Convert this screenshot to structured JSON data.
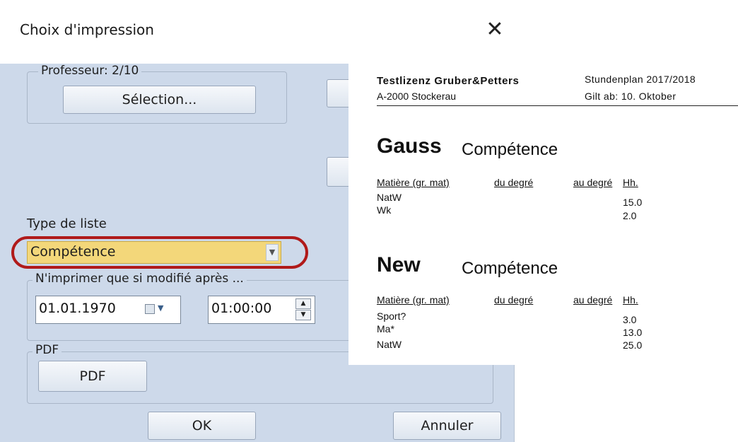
{
  "dialog": {
    "title": "Choix d'impression",
    "close_glyph": "✕",
    "professeur_legend": "Professeur: 2/10",
    "selection_button": "Sélection...",
    "type_liste_label": "Type de liste",
    "type_liste_value": "Compétence",
    "modified_legend": "N'imprimer que si modifié après ...",
    "date_value": "01.01.1970",
    "time_value": "01:00:00",
    "pdf_legend": "PDF",
    "pdf_button": "PDF",
    "ok_button": "OK",
    "cancel_button": "Annuler",
    "highlight_color": "#b01a1a",
    "selected_bg": "#f3d77a"
  },
  "preview": {
    "school": "Testlizenz Gruber&Petters",
    "address": "A-2000 Stockerau",
    "plan": "Stundenplan 2017/2018",
    "valid_from": "Gilt ab: 10. Oktober",
    "col_headers": {
      "subject": "Matière (gr. mat)",
      "from": "du degré",
      "to": "au degré",
      "hours": "Hh."
    },
    "teachers": [
      {
        "name": "Gauss",
        "type": "Compétence",
        "rows": [
          {
            "subject": "NatW",
            "hours": "15.0"
          },
          {
            "subject": "Wk",
            "hours": "2.0"
          }
        ]
      },
      {
        "name": "New",
        "type": "Compétence",
        "rows": [
          {
            "subject": "Sport?",
            "hours": "3.0"
          },
          {
            "subject": "Ma*",
            "hours": "13.0"
          },
          {
            "subject": "NatW",
            "hours": "25.0"
          }
        ]
      }
    ]
  }
}
